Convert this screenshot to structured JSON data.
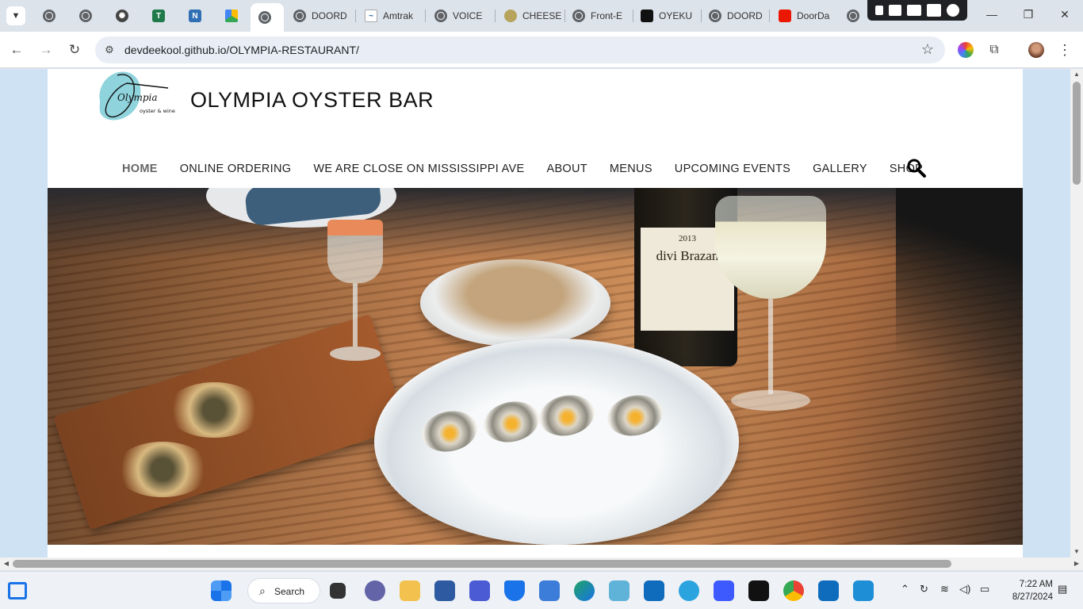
{
  "browser": {
    "tabs": [
      {
        "title": "",
        "favicon": "globe-icon"
      },
      {
        "title": "",
        "favicon": "globe-icon"
      },
      {
        "title": "",
        "favicon": "openai-icon"
      },
      {
        "title": "",
        "favicon": "tulane-icon"
      },
      {
        "title": "",
        "favicon": "notion-icon"
      },
      {
        "title": "",
        "favicon": "drive-icon"
      },
      {
        "title": "",
        "favicon": "globe-icon",
        "active": true
      },
      {
        "title": "DOORD",
        "favicon": "globe-icon"
      },
      {
        "title": "Amtrak",
        "favicon": "amtrak-icon"
      },
      {
        "title": "VOICE",
        "favicon": "globe-icon"
      },
      {
        "title": "CHEESE",
        "favicon": "cheese-icon"
      },
      {
        "title": "Front-E",
        "favicon": "globe-icon"
      },
      {
        "title": "OYEKU",
        "favicon": "codesandbox-icon"
      },
      {
        "title": "DOORD",
        "favicon": "globe-icon"
      },
      {
        "title": "DoorDa",
        "favicon": "doordash-icon"
      }
    ],
    "url": "devdeekool.github.io/OLYMPIA-RESTAURANT/",
    "window_controls": {
      "minimize": "—",
      "restore": "❐",
      "close": "✕"
    }
  },
  "site": {
    "logo_text": "Olympia",
    "logo_subtext": "oyster & wine",
    "title": "OLYMPIA OYSTER BAR",
    "nav": [
      {
        "label": "HOME",
        "current": true
      },
      {
        "label": "ONLINE ORDERING"
      },
      {
        "label": "WE ARE CLOSE ON MISSISSIPPI AVE"
      },
      {
        "label": "ABOUT"
      },
      {
        "label": "MENUS"
      },
      {
        "label": "UPCOMING EVENTS"
      },
      {
        "label": "GALLERY"
      },
      {
        "label": "SHOP"
      }
    ],
    "hero_wine_label": "divi Brazan",
    "hero_wine_year": "2013"
  },
  "taskbar": {
    "search_label": "Search",
    "time": "7:22 AM",
    "date": "8/27/2024"
  },
  "colors": {
    "page_bg": "#cfe2f3",
    "logo_blob": "#8fd3dc",
    "windows_blue": "#1a73e8"
  }
}
